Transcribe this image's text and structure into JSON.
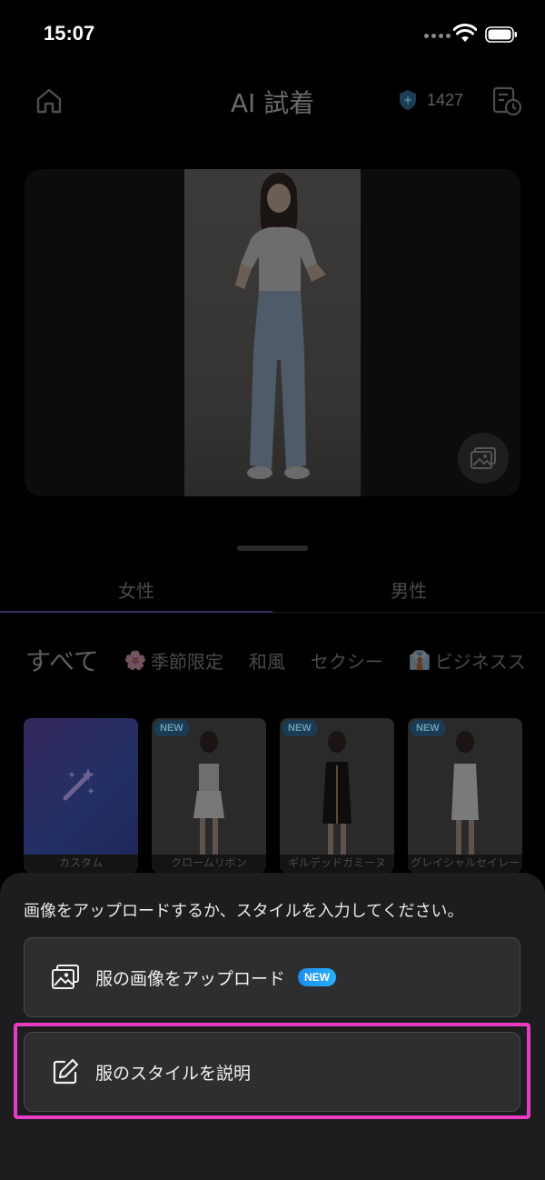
{
  "status_bar": {
    "time": "15:07"
  },
  "header": {
    "title": "AI 試着",
    "credits": "1427"
  },
  "gender_tabs": [
    "女性",
    "男性"
  ],
  "categories": [
    {
      "label": "すべて",
      "icon": ""
    },
    {
      "label": "季節限定",
      "icon": "🌸"
    },
    {
      "label": "和風",
      "icon": ""
    },
    {
      "label": "セクシー",
      "icon": ""
    },
    {
      "label": "ビジネスス",
      "icon": "👔"
    }
  ],
  "styles": [
    {
      "label": "カスタム",
      "badge": ""
    },
    {
      "label": "クロームリボン",
      "badge": "NEW"
    },
    {
      "label": "ギルデッドガミーヌ",
      "badge": "NEW"
    },
    {
      "label": "グレイシャルセイレーン",
      "badge": "NEW"
    }
  ],
  "sheet": {
    "prompt": "画像をアップロードするか、スタイルを入力してください。",
    "upload_label": "服の画像をアップロード",
    "upload_badge": "NEW",
    "describe_label": "服のスタイルを説明"
  },
  "colors": {
    "highlight": "#ea3bc4",
    "new_badge": "#1c8dee",
    "sheet_bg": "#1d1d1f",
    "option_bg": "#2e2e30"
  }
}
